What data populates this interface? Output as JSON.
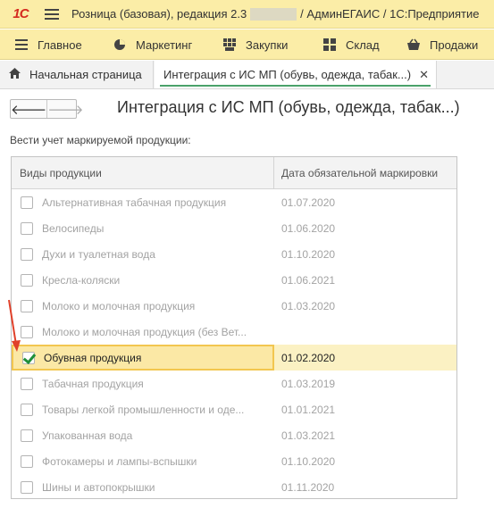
{
  "titlebar": {
    "logo": "1С",
    "title_left": "Розница (базовая), редакция 2.3",
    "title_right": "/ АдминЕГАИС / 1С:Предприятие"
  },
  "sections": [
    {
      "label": "Главное",
      "icon": "hamburger-icon"
    },
    {
      "label": "Маркетинг",
      "icon": "pie-chart-icon"
    },
    {
      "label": "Закупки",
      "icon": "grid-icon"
    },
    {
      "label": "Склад",
      "icon": "warehouse-icon"
    },
    {
      "label": "Продажи",
      "icon": "basket-icon"
    }
  ],
  "tabs": {
    "home": "Начальная страница",
    "active": "Интеграция с ИС МП (обувь, одежда, табак...)"
  },
  "form": {
    "title": "Интеграция с ИС МП (обувь, одежда, табак...)",
    "caption": "Вести учет маркируемой продукции:"
  },
  "table": {
    "headers": [
      "Виды продукции",
      "Дата обязательной маркировки"
    ],
    "rows": [
      {
        "name": "Альтернативная табачная продукция",
        "date": "01.07.2020",
        "checked": false
      },
      {
        "name": "Велосипеды",
        "date": "01.06.2020",
        "checked": false
      },
      {
        "name": "Духи и туалетная вода",
        "date": "01.10.2020",
        "checked": false
      },
      {
        "name": "Кресла-коляски",
        "date": "01.06.2021",
        "checked": false
      },
      {
        "name": "Молоко и молочная продукция",
        "date": "01.03.2020",
        "checked": false
      },
      {
        "name": "Молоко и молочная продукция (без Вет...",
        "date": "",
        "checked": false
      },
      {
        "name": "Обувная продукция",
        "date": "01.02.2020",
        "checked": true
      },
      {
        "name": "Табачная продукция",
        "date": "01.03.2019",
        "checked": false
      },
      {
        "name": "Товары легкой промышленности и оде...",
        "date": "01.01.2021",
        "checked": false
      },
      {
        "name": "Упакованная вода",
        "date": "01.03.2021",
        "checked": false
      },
      {
        "name": "Фотокамеры и лампы-вспышки",
        "date": "01.10.2020",
        "checked": false
      },
      {
        "name": "Шины и автопокрышки",
        "date": "01.11.2020",
        "checked": false
      }
    ]
  },
  "colors": {
    "accent": "#fbeda7",
    "selected_row": "#fbe8a5",
    "checkmark": "#1f8f3a",
    "annotation_arrow": "#e0402a"
  }
}
